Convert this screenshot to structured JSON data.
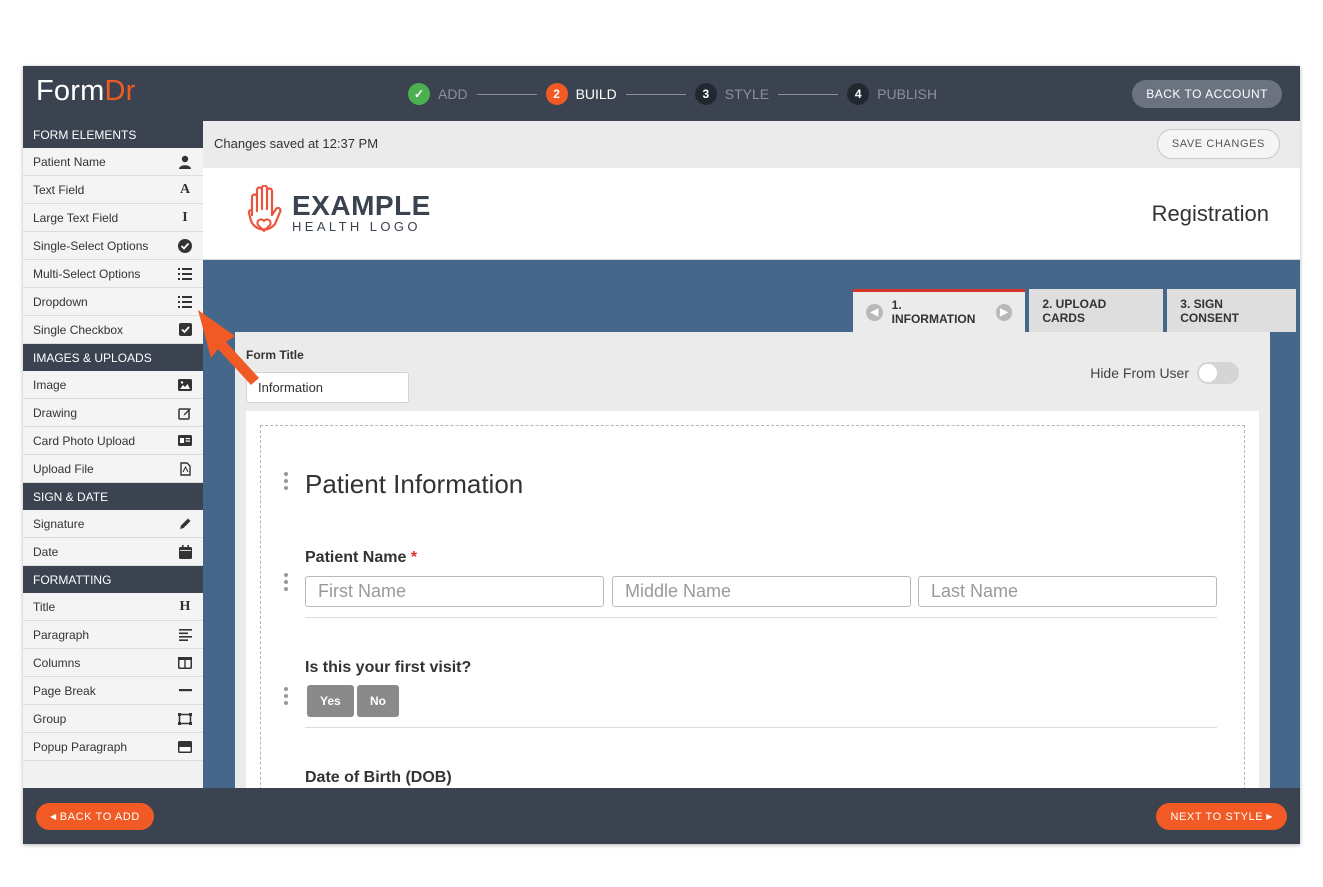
{
  "app": {
    "logo_form": "Form",
    "logo_dr": "Dr",
    "back_to_account": "BACK TO ACCOUNT"
  },
  "steps": [
    {
      "number": "✓",
      "label": "ADD"
    },
    {
      "number": "2",
      "label": "BUILD"
    },
    {
      "number": "3",
      "label": "STYLE"
    },
    {
      "number": "4",
      "label": "PUBLISH"
    }
  ],
  "sidebar": {
    "sections": [
      {
        "title": "FORM ELEMENTS",
        "items": [
          {
            "label": "Patient Name",
            "icon": "user-icon"
          },
          {
            "label": "Text Field",
            "icon": "text-a-icon"
          },
          {
            "label": "Large Text Field",
            "icon": "text-cursor-icon"
          },
          {
            "label": "Single-Select Options",
            "icon": "check-circle-icon"
          },
          {
            "label": "Multi-Select Options",
            "icon": "list-icon"
          },
          {
            "label": "Dropdown",
            "icon": "list-icon"
          },
          {
            "label": "Single Checkbox",
            "icon": "checkbox-icon"
          }
        ]
      },
      {
        "title": "IMAGES & UPLOADS",
        "items": [
          {
            "label": "Image",
            "icon": "image-icon"
          },
          {
            "label": "Drawing",
            "icon": "edit-icon"
          },
          {
            "label": "Card Photo Upload",
            "icon": "id-card-icon"
          },
          {
            "label": "Upload File",
            "icon": "file-pdf-icon"
          }
        ]
      },
      {
        "title": "SIGN & DATE",
        "items": [
          {
            "label": "Signature",
            "icon": "pencil-icon"
          },
          {
            "label": "Date",
            "icon": "calendar-icon"
          }
        ]
      },
      {
        "title": "FORMATTING",
        "items": [
          {
            "label": "Title",
            "icon": "heading-icon"
          },
          {
            "label": "Paragraph",
            "icon": "align-left-icon"
          },
          {
            "label": "Columns",
            "icon": "columns-icon"
          },
          {
            "label": "Page Break",
            "icon": "minus-icon"
          },
          {
            "label": "Group",
            "icon": "group-icon"
          },
          {
            "label": "Popup Paragraph",
            "icon": "window-icon"
          }
        ]
      }
    ]
  },
  "main": {
    "saved_status": "Changes saved at 12:37 PM",
    "save_changes": "SAVE CHANGES",
    "brand_big": "EXAMPLE",
    "brand_small": "HEALTH LOGO",
    "page_title": "Registration",
    "tabs": [
      "1. INFORMATION",
      "2. UPLOAD CARDS",
      "3. SIGN CONSENT"
    ],
    "form_title_label": "Form Title",
    "form_title_value": "Information",
    "hide_from_user": "Hide From User",
    "section_title": "Patient Information",
    "patient_name_label": "Patient Name",
    "required_mark": "*",
    "first_name_placeholder": "First Name",
    "middle_name_placeholder": "Middle Name",
    "last_name_placeholder": "Last Name",
    "first_visit_label": "Is this your first visit?",
    "yes": "Yes",
    "no": "No",
    "dob_label": "Date of Birth (DOB)"
  },
  "footer": {
    "back_to_add": "BACK TO ADD",
    "next_to_style": "NEXT TO STYLE"
  },
  "colors": {
    "accent": "#f15a24",
    "dark": "#3b4350",
    "blue": "#456789",
    "success": "#4caf50"
  }
}
